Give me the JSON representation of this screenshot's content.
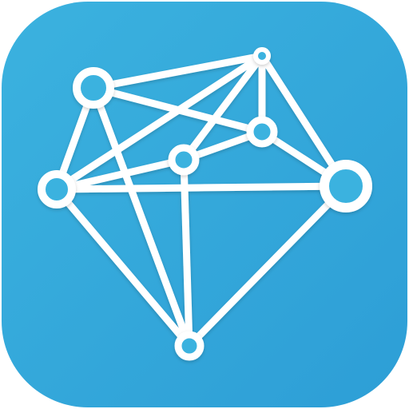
{
  "icon": {
    "name": "network-graph-icon",
    "colors": {
      "background_light": "#3bb2df",
      "background_dark": "#2d9ed6",
      "foreground": "#ffffff"
    }
  }
}
